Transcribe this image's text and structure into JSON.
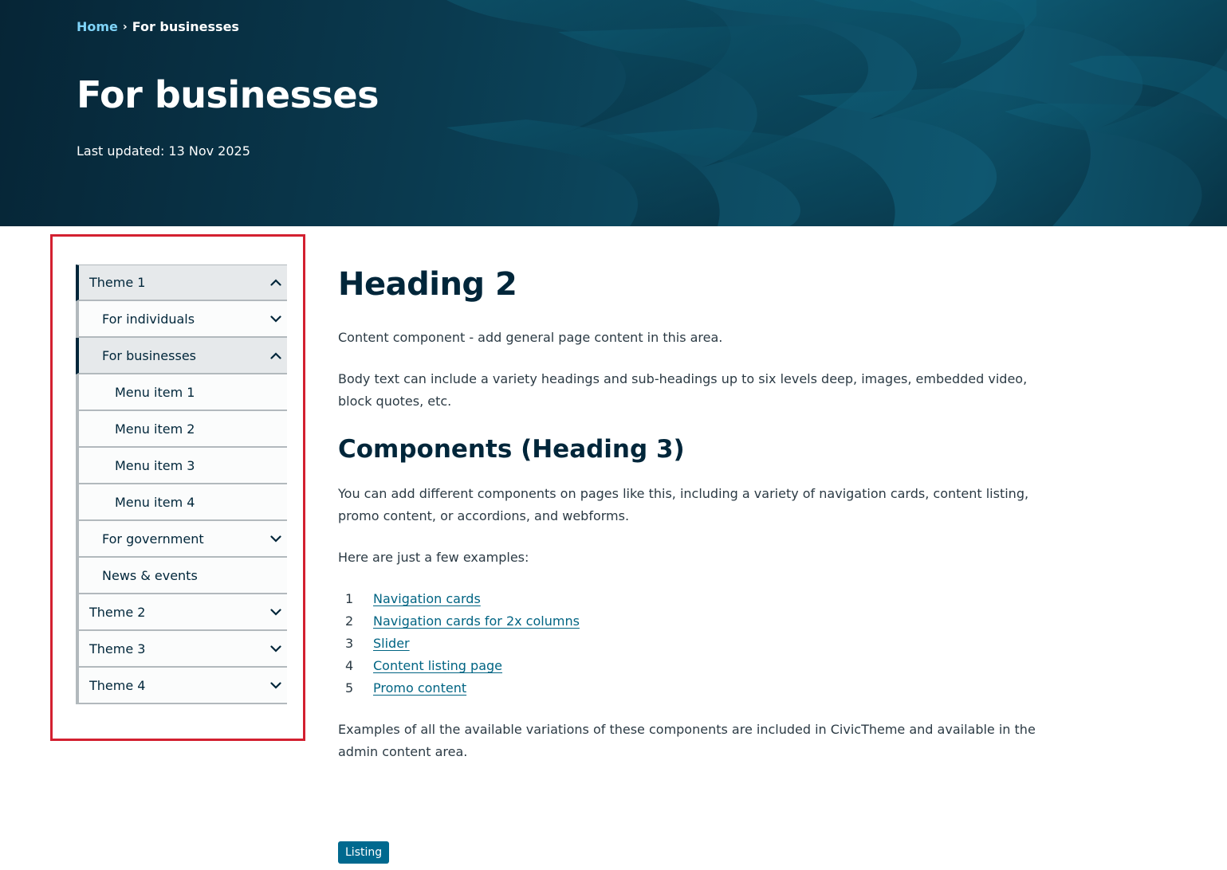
{
  "breadcrumb": {
    "home": "Home",
    "separator": "›",
    "current": "For businesses"
  },
  "hero": {
    "title": "For businesses",
    "updated": "Last updated: 13 Nov 2025"
  },
  "sidenav": {
    "items": [
      {
        "label": "Theme 1",
        "icon": "chevron-up-icon"
      },
      {
        "label": "For individuals",
        "icon": "chevron-down-icon"
      },
      {
        "label": "For businesses",
        "icon": "chevron-up-icon"
      },
      {
        "label": "Menu item 1"
      },
      {
        "label": "Menu item 2"
      },
      {
        "label": "Menu item 3"
      },
      {
        "label": "Menu item 4"
      },
      {
        "label": "For government",
        "icon": "chevron-down-icon"
      },
      {
        "label": "News & events"
      },
      {
        "label": "Theme 2",
        "icon": "chevron-down-icon"
      },
      {
        "label": "Theme 3",
        "icon": "chevron-down-icon"
      },
      {
        "label": "Theme 4",
        "icon": "chevron-down-icon"
      }
    ]
  },
  "content": {
    "heading2": "Heading 2",
    "intro": "Content component - add general page content in this area.",
    "body": "Body text can include a variety headings and sub-headings up to six levels deep, images, embedded video, block quotes, etc.",
    "heading3": "Components (Heading 3)",
    "components_text": "You can add different components on pages like this, including a variety of navigation cards, content listing, promo content, or accordions, and webforms.",
    "examples_intro": "Here are just a few examples:",
    "examples": [
      {
        "num": "1",
        "label": "Navigation cards"
      },
      {
        "num": "2",
        "label": "Navigation cards for 2x columns"
      },
      {
        "num": "3",
        "label": "Slider"
      },
      {
        "num": "4",
        "label": "Content listing page"
      },
      {
        "num": "5",
        "label": "Promo content"
      }
    ],
    "closing": "Examples of all the available variations of these components are included in CivicTheme and available in the admin content area."
  },
  "tag": {
    "label": "Listing"
  },
  "colors": {
    "accent_link": "#006483",
    "heading": "#00263a",
    "highlight": "#d32030",
    "tag_bg": "#00698f"
  }
}
